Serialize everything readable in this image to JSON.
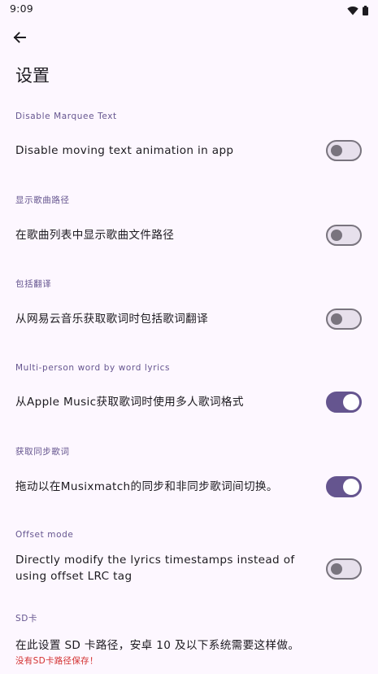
{
  "status_bar": {
    "time": "9:09",
    "icons": [
      "wifi-icon",
      "battery-icon"
    ]
  },
  "toolbar": {
    "back_icon": "arrow-back-icon"
  },
  "page": {
    "title": "设置"
  },
  "colors": {
    "background": "#fdf7ff",
    "accent": "#65558f",
    "text": "#1d1b20",
    "switch_off_track": "#e7e0ec",
    "switch_off_outline": "#79747e",
    "warning": "#d32f2f"
  },
  "sections": [
    {
      "header": "Disable Marquee Text",
      "text": "Disable moving text animation in app",
      "switch_on": false
    },
    {
      "header": "显示歌曲路径",
      "text": "在歌曲列表中显示歌曲文件路径",
      "switch_on": false
    },
    {
      "header": "包括翻译",
      "text": "从网易云音乐获取歌词时包括歌词翻译",
      "switch_on": false
    },
    {
      "header": "Multi-person word by word lyrics",
      "text": "从Apple Music获取歌词时使用多人歌词格式",
      "switch_on": true
    },
    {
      "header": "获取同步歌词",
      "text": "拖动以在Musixmatch的同步和非同步歌词间切换。",
      "switch_on": true
    },
    {
      "header": "Offset mode",
      "text": "Directly modify the lyrics timestamps instead of using offset LRC tag",
      "switch_on": false
    },
    {
      "header": "SD卡",
      "text": "在此设置 SD 卡路径，安卓 10 及以下系统需要这样做。",
      "subtext": "没有SD卡路径保存！"
    }
  ]
}
